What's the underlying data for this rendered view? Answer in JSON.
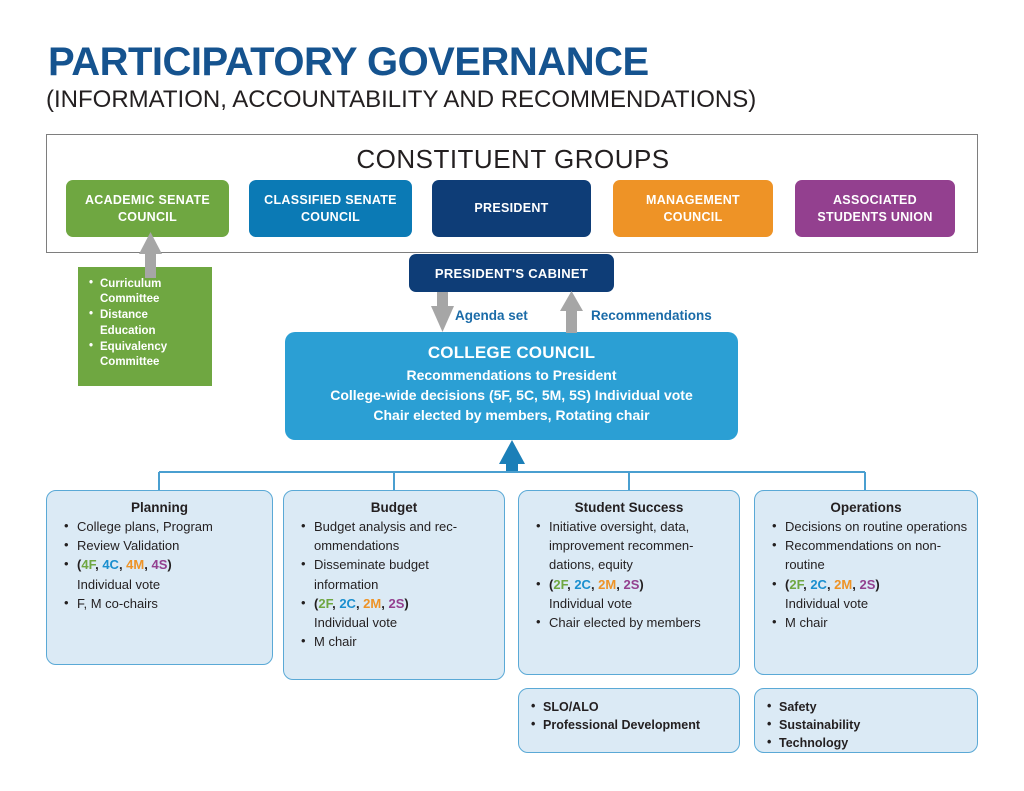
{
  "header": {
    "title": "PARTICIPATORY GOVERNANCE",
    "subtitle": "(INFORMATION, ACCOUNTABILITY AND RECOMMENDATIONS)",
    "title_color": "#15538f"
  },
  "constituent_groups": {
    "section_title": "CONSTITUENT GROUPS",
    "items": [
      {
        "label": "ACADEMIC  SENATE COUNCIL",
        "color": "#6fa741"
      },
      {
        "label": "CLASSIFIED SENATE COUNCIL",
        "color": "#0b7ab5"
      },
      {
        "label": "PRESIDENT",
        "color": "#0e3d77"
      },
      {
        "label": "MANAGEMENT COUNCIL",
        "color": "#ee9326"
      },
      {
        "label": "ASSOCIATED STUDENTS UNION",
        "color": "#93408f"
      }
    ]
  },
  "academic_senate_committees": {
    "color": "#6fa741",
    "items": [
      "Curriculum Committee",
      "Distance Education",
      "Equivalency Committee"
    ]
  },
  "cabinet": {
    "label": "PRESIDENT'S CABINET",
    "color": "#0e3d77"
  },
  "flow_labels": {
    "down": "Agenda set",
    "up": "Recommendations",
    "color": "#1a6ba8",
    "arrow_color": "#a6a6a6"
  },
  "college_council": {
    "title": "COLLEGE COUNCIL",
    "color": "#2b9fd4",
    "lines": [
      "Recommendations to President",
      "College-wide decisions (5F, 5C, 5M, 5S) Individual vote",
      "Chair elected by members, Rotating chair"
    ]
  },
  "committees": [
    {
      "title": "Planning",
      "items": [
        {
          "type": "text",
          "text": "College plans, Program"
        },
        {
          "type": "text",
          "text": "Review Validation"
        },
        {
          "type": "votes",
          "codes": [
            "4F",
            "4C",
            "4M",
            "4S"
          ],
          "suffix": "Individual vote"
        },
        {
          "type": "text",
          "text": "F, M co-chairs"
        }
      ]
    },
    {
      "title": "Budget",
      "items": [
        {
          "type": "text",
          "text": "Budget analysis and rec-ommendations"
        },
        {
          "type": "text",
          "text": "Disseminate budget information"
        },
        {
          "type": "votes",
          "codes": [
            "2F",
            "2C",
            "2M",
            "2S"
          ],
          "suffix": "Individual vote"
        },
        {
          "type": "text",
          "text": "M chair"
        }
      ]
    },
    {
      "title": "Student Success",
      "items": [
        {
          "type": "text",
          "text": "Initiative oversight, data, improvement recommen-dations, equity"
        },
        {
          "type": "votes",
          "codes": [
            "2F",
            "2C",
            "2M",
            "2S"
          ],
          "suffix": "Individual vote"
        },
        {
          "type": "text",
          "text": "Chair elected by members"
        }
      ]
    },
    {
      "title": "Operations",
      "items": [
        {
          "type": "text",
          "text": "Decisions on routine operations"
        },
        {
          "type": "text",
          "text": "Recommendations on non-routine"
        },
        {
          "type": "votes",
          "codes": [
            "2F",
            "2C",
            "2M",
            "2S"
          ],
          "suffix": "Individual vote"
        },
        {
          "type": "text",
          "text": "M chair"
        }
      ]
    }
  ],
  "subcommittees": [
    {
      "parent": "Student Success",
      "items": [
        "SLO/ALO",
        "Professional Development"
      ]
    },
    {
      "parent": "Operations",
      "items": [
        "Safety",
        "Sustainability",
        "Technology"
      ]
    }
  ],
  "vote_code_colors": {
    "F": "#6fa741",
    "C": "#1a8fcf",
    "M": "#ee9326",
    "S": "#93408f"
  },
  "connector_color": "#4a9fd0"
}
